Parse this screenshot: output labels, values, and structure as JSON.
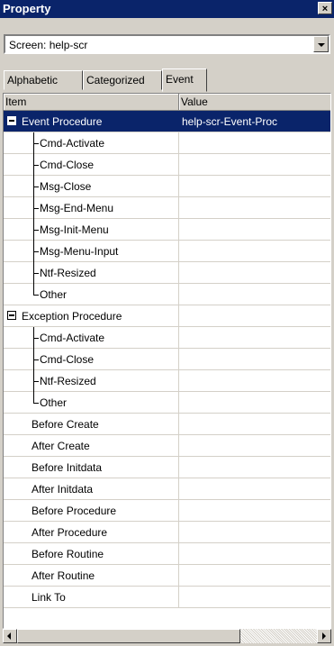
{
  "window": {
    "title": "Property",
    "close_label": "×"
  },
  "combo": {
    "value": "Screen:  help-scr"
  },
  "tabs": [
    "Alphabetic",
    "Categorized",
    "Event"
  ],
  "columns": {
    "item": "Item",
    "value": "Value"
  },
  "rows": [
    {
      "label": "Event Procedure",
      "value": "help-scr-Event-Proc"
    },
    {
      "label": "Cmd-Activate",
      "value": ""
    },
    {
      "label": "Cmd-Close",
      "value": ""
    },
    {
      "label": "Msg-Close",
      "value": ""
    },
    {
      "label": "Msg-End-Menu",
      "value": ""
    },
    {
      "label": "Msg-Init-Menu",
      "value": ""
    },
    {
      "label": "Msg-Menu-Input",
      "value": ""
    },
    {
      "label": "Ntf-Resized",
      "value": ""
    },
    {
      "label": "Other",
      "value": ""
    },
    {
      "label": "Exception Procedure",
      "value": ""
    },
    {
      "label": "Cmd-Activate",
      "value": ""
    },
    {
      "label": "Cmd-Close",
      "value": ""
    },
    {
      "label": "Ntf-Resized",
      "value": ""
    },
    {
      "label": "Other",
      "value": ""
    },
    {
      "label": "Before Create",
      "value": ""
    },
    {
      "label": "After Create",
      "value": ""
    },
    {
      "label": "Before Initdata",
      "value": ""
    },
    {
      "label": "After Initdata",
      "value": ""
    },
    {
      "label": "Before Procedure",
      "value": ""
    },
    {
      "label": "After Procedure",
      "value": ""
    },
    {
      "label": "Before Routine",
      "value": ""
    },
    {
      "label": "After Routine",
      "value": ""
    },
    {
      "label": "Link To",
      "value": ""
    }
  ],
  "colors": {
    "selection": "#0a246a",
    "face": "#d4d0c8"
  }
}
